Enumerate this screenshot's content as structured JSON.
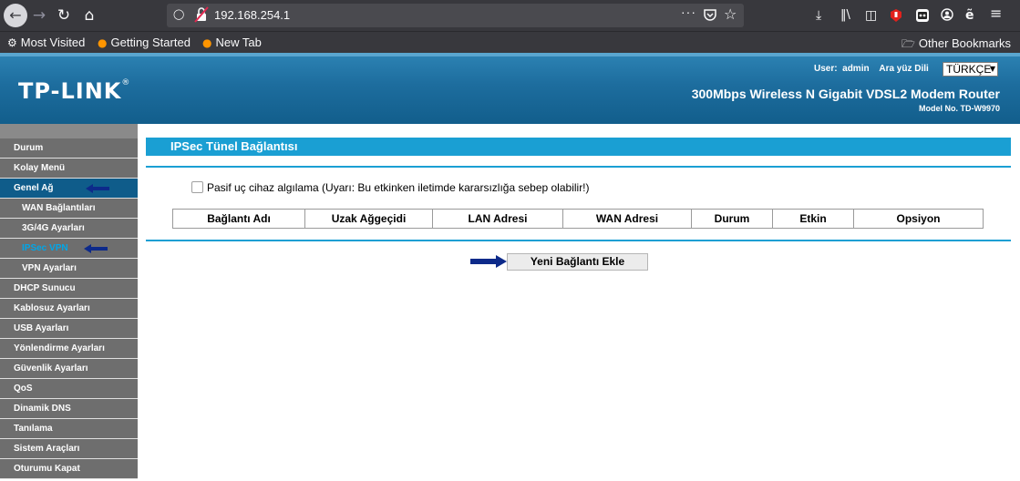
{
  "browser": {
    "url": "192.168.254.1",
    "url_actions": "···",
    "bookmarks": [
      {
        "label": "Most Visited",
        "icon": "gear-icon"
      },
      {
        "label": "Getting Started",
        "icon": "firefox-icon"
      },
      {
        "label": "New Tab",
        "icon": "firefox-icon"
      }
    ],
    "other_bookmarks": "Other Bookmarks"
  },
  "header": {
    "logo": "TP-LINK",
    "user_label": "User:",
    "user_value": "admin",
    "language_label": "Ara yüz Dili",
    "language_value": "TÜRKÇE",
    "product_name": "300Mbps Wireless N Gigabit VDSL2 Modem Router",
    "model_no": "Model No. TD-W9970"
  },
  "sidebar": {
    "items": [
      {
        "label": "Durum"
      },
      {
        "label": "Kolay Menü"
      },
      {
        "label": "Genel Ağ"
      },
      {
        "label": "WAN Bağlantıları"
      },
      {
        "label": "3G/4G Ayarları"
      },
      {
        "label": "IPSec VPN"
      },
      {
        "label": "VPN Ayarları"
      },
      {
        "label": "DHCP Sunucu"
      },
      {
        "label": "Kablosuz Ayarları"
      },
      {
        "label": "USB Ayarları"
      },
      {
        "label": "Yönlendirme Ayarları"
      },
      {
        "label": "Güvenlik Ayarları"
      },
      {
        "label": "QoS"
      },
      {
        "label": "Dinamik DNS"
      },
      {
        "label": "Tanılama"
      },
      {
        "label": "Sistem Araçları"
      },
      {
        "label": "Oturumu Kapat"
      }
    ]
  },
  "main": {
    "title": "IPSec Tünel Bağlantısı",
    "dpd_label": "Pasif uç cihaz algılama (Uyarı: Bu etkinken iletimde kararsızlığa sebep olabilir!)",
    "table_headers": [
      "Bağlantı Adı",
      "Uzak Ağgeçidi",
      "LAN Adresi",
      "WAN Adresi",
      "Durum",
      "Etkin",
      "Opsiyon"
    ],
    "add_button": "Yeni Bağlantı Ekle"
  },
  "colors": {
    "accent": "#1a9fd3",
    "header_blue": "#1d6d9e",
    "menu_gray": "#6e6e6e",
    "menu_active": "#0f5c8a",
    "arrow_navy": "#0d2a8a"
  }
}
